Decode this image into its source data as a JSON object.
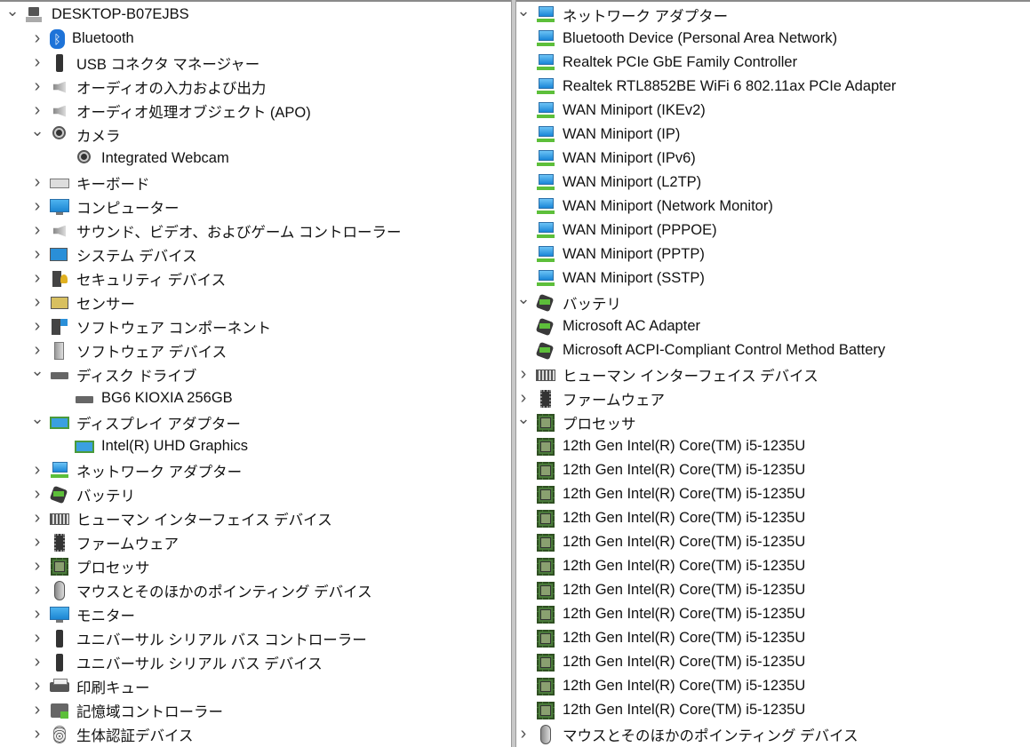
{
  "left_tree": [
    {
      "level": 0,
      "expand": "open",
      "icon": "computer",
      "label": "DESKTOP-B07EJBS"
    },
    {
      "level": 1,
      "expand": "closed",
      "icon": "bluetooth",
      "label": "Bluetooth"
    },
    {
      "level": 1,
      "expand": "closed",
      "icon": "usb",
      "label": "USB コネクタ マネージャー"
    },
    {
      "level": 1,
      "expand": "closed",
      "icon": "speaker",
      "label": "オーディオの入力および出力"
    },
    {
      "level": 1,
      "expand": "closed",
      "icon": "speaker",
      "label": "オーディオ処理オブジェクト (APO)"
    },
    {
      "level": 1,
      "expand": "open",
      "icon": "camera",
      "label": "カメラ"
    },
    {
      "level": 2,
      "expand": "none",
      "icon": "camera",
      "label": "Integrated Webcam"
    },
    {
      "level": 1,
      "expand": "closed",
      "icon": "keyboard",
      "label": "キーボード"
    },
    {
      "level": 1,
      "expand": "closed",
      "icon": "monitor",
      "label": "コンピューター"
    },
    {
      "level": 1,
      "expand": "closed",
      "icon": "speaker",
      "label": "サウンド、ビデオ、およびゲーム コントローラー"
    },
    {
      "level": 1,
      "expand": "closed",
      "icon": "system",
      "label": "システム デバイス"
    },
    {
      "level": 1,
      "expand": "closed",
      "icon": "security",
      "label": "セキュリティ デバイス"
    },
    {
      "level": 1,
      "expand": "closed",
      "icon": "sensor",
      "label": "センサー"
    },
    {
      "level": 1,
      "expand": "closed",
      "icon": "software",
      "label": "ソフトウェア コンポーネント"
    },
    {
      "level": 1,
      "expand": "closed",
      "icon": "softdev",
      "label": "ソフトウェア デバイス"
    },
    {
      "level": 1,
      "expand": "open",
      "icon": "disk",
      "label": "ディスク ドライブ"
    },
    {
      "level": 2,
      "expand": "none",
      "icon": "disk",
      "label": "BG6 KIOXIA 256GB"
    },
    {
      "level": 1,
      "expand": "open",
      "icon": "display",
      "label": "ディスプレイ アダプター"
    },
    {
      "level": 2,
      "expand": "none",
      "icon": "display",
      "label": "Intel(R) UHD Graphics"
    },
    {
      "level": 1,
      "expand": "closed",
      "icon": "network",
      "label": "ネットワーク アダプター"
    },
    {
      "level": 1,
      "expand": "closed",
      "icon": "battery",
      "label": "バッテリ"
    },
    {
      "level": 1,
      "expand": "closed",
      "icon": "hid",
      "label": "ヒューマン インターフェイス デバイス"
    },
    {
      "level": 1,
      "expand": "closed",
      "icon": "firmware",
      "label": "ファームウェア"
    },
    {
      "level": 1,
      "expand": "closed",
      "icon": "cpu",
      "label": "プロセッサ"
    },
    {
      "level": 1,
      "expand": "closed",
      "icon": "mouse",
      "label": "マウスとそのほかのポインティング デバイス"
    },
    {
      "level": 1,
      "expand": "closed",
      "icon": "monitor",
      "label": "モニター"
    },
    {
      "level": 1,
      "expand": "closed",
      "icon": "usb",
      "label": "ユニバーサル シリアル バス コントローラー"
    },
    {
      "level": 1,
      "expand": "closed",
      "icon": "usb",
      "label": "ユニバーサル シリアル バス デバイス"
    },
    {
      "level": 1,
      "expand": "closed",
      "icon": "printer",
      "label": "印刷キュー"
    },
    {
      "level": 1,
      "expand": "closed",
      "icon": "storage",
      "label": "記憶域コントローラー"
    },
    {
      "level": 1,
      "expand": "closed",
      "icon": "biometric",
      "label": "生体認証デバイス"
    }
  ],
  "right_tree": [
    {
      "level": 1,
      "expand": "open",
      "icon": "network",
      "label": "ネットワーク アダプター"
    },
    {
      "level": 2,
      "expand": "none",
      "icon": "network",
      "label": "Bluetooth Device (Personal Area Network)"
    },
    {
      "level": 2,
      "expand": "none",
      "icon": "network",
      "label": "Realtek PCIe GbE Family Controller"
    },
    {
      "level": 2,
      "expand": "none",
      "icon": "network",
      "label": "Realtek RTL8852BE WiFi 6 802.11ax PCIe Adapter"
    },
    {
      "level": 2,
      "expand": "none",
      "icon": "network",
      "label": "WAN Miniport (IKEv2)"
    },
    {
      "level": 2,
      "expand": "none",
      "icon": "network",
      "label": "WAN Miniport (IP)"
    },
    {
      "level": 2,
      "expand": "none",
      "icon": "network",
      "label": "WAN Miniport (IPv6)"
    },
    {
      "level": 2,
      "expand": "none",
      "icon": "network",
      "label": "WAN Miniport (L2TP)"
    },
    {
      "level": 2,
      "expand": "none",
      "icon": "network",
      "label": "WAN Miniport (Network Monitor)"
    },
    {
      "level": 2,
      "expand": "none",
      "icon": "network",
      "label": "WAN Miniport (PPPOE)"
    },
    {
      "level": 2,
      "expand": "none",
      "icon": "network",
      "label": "WAN Miniport (PPTP)"
    },
    {
      "level": 2,
      "expand": "none",
      "icon": "network",
      "label": "WAN Miniport (SSTP)"
    },
    {
      "level": 1,
      "expand": "open",
      "icon": "battery",
      "label": "バッテリ"
    },
    {
      "level": 2,
      "expand": "none",
      "icon": "battery",
      "label": "Microsoft AC Adapter"
    },
    {
      "level": 2,
      "expand": "none",
      "icon": "battery",
      "label": "Microsoft ACPI-Compliant Control Method Battery"
    },
    {
      "level": 1,
      "expand": "closed",
      "icon": "hid",
      "label": "ヒューマン インターフェイス デバイス"
    },
    {
      "level": 1,
      "expand": "closed",
      "icon": "firmware",
      "label": "ファームウェア"
    },
    {
      "level": 1,
      "expand": "open",
      "icon": "cpu",
      "label": "プロセッサ"
    },
    {
      "level": 2,
      "expand": "none",
      "icon": "cpu",
      "label": "12th Gen Intel(R) Core(TM) i5-1235U"
    },
    {
      "level": 2,
      "expand": "none",
      "icon": "cpu",
      "label": "12th Gen Intel(R) Core(TM) i5-1235U"
    },
    {
      "level": 2,
      "expand": "none",
      "icon": "cpu",
      "label": "12th Gen Intel(R) Core(TM) i5-1235U"
    },
    {
      "level": 2,
      "expand": "none",
      "icon": "cpu",
      "label": "12th Gen Intel(R) Core(TM) i5-1235U"
    },
    {
      "level": 2,
      "expand": "none",
      "icon": "cpu",
      "label": "12th Gen Intel(R) Core(TM) i5-1235U"
    },
    {
      "level": 2,
      "expand": "none",
      "icon": "cpu",
      "label": "12th Gen Intel(R) Core(TM) i5-1235U"
    },
    {
      "level": 2,
      "expand": "none",
      "icon": "cpu",
      "label": "12th Gen Intel(R) Core(TM) i5-1235U"
    },
    {
      "level": 2,
      "expand": "none",
      "icon": "cpu",
      "label": "12th Gen Intel(R) Core(TM) i5-1235U"
    },
    {
      "level": 2,
      "expand": "none",
      "icon": "cpu",
      "label": "12th Gen Intel(R) Core(TM) i5-1235U"
    },
    {
      "level": 2,
      "expand": "none",
      "icon": "cpu",
      "label": "12th Gen Intel(R) Core(TM) i5-1235U"
    },
    {
      "level": 2,
      "expand": "none",
      "icon": "cpu",
      "label": "12th Gen Intel(R) Core(TM) i5-1235U"
    },
    {
      "level": 2,
      "expand": "none",
      "icon": "cpu",
      "label": "12th Gen Intel(R) Core(TM) i5-1235U"
    },
    {
      "level": 1,
      "expand": "closed",
      "icon": "mouse",
      "label": "マウスとそのほかのポインティング デバイス"
    }
  ]
}
